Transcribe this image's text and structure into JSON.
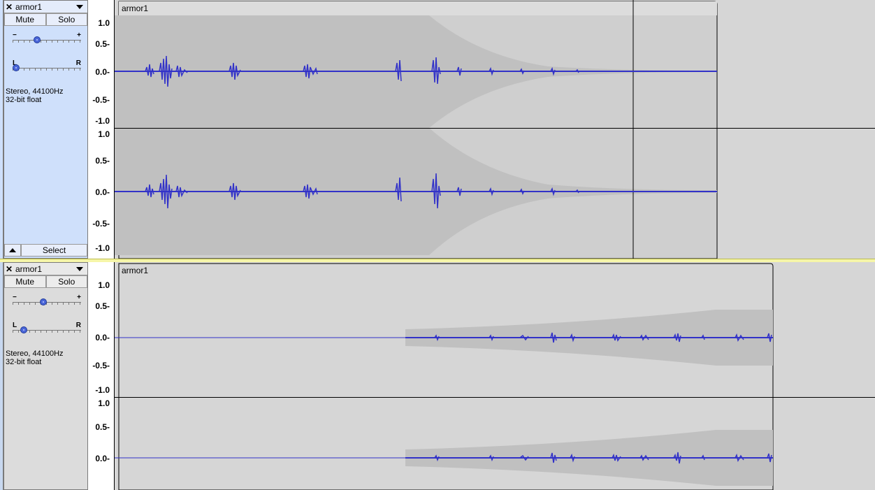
{
  "tracks": [
    {
      "name": "armor1",
      "mute_label": "Mute",
      "solo_label": "Solo",
      "gain_minus": "−",
      "gain_plus": "+",
      "gain_level": 0.34,
      "pan_left": "L",
      "pan_right": "R",
      "pan_level": 0.0,
      "info_line1": "Stereo, 44100Hz",
      "info_line2": "32-bit float",
      "select_label": "Select",
      "clip_name": "armor1",
      "ruler_top": [
        "1.0",
        "0.5-",
        "0.0-",
        "-0.5-",
        "-1.0"
      ],
      "ruler_bottom": [
        "1.0",
        "0.5-",
        "0.0-",
        "-0.5-",
        "-1.0"
      ]
    },
    {
      "name": "armor1",
      "mute_label": "Mute",
      "solo_label": "Solo",
      "gain_minus": "−",
      "gain_plus": "+",
      "gain_level": 0.44,
      "pan_left": "L",
      "pan_right": "R",
      "pan_level": 0.13,
      "info_line1": "Stereo, 44100Hz",
      "info_line2": "32-bit float",
      "clip_name": "armor1",
      "ruler_top": [
        "1.0",
        "0.5-",
        "0.0-",
        "-0.5-",
        "-1.0"
      ],
      "ruler_bottom": [
        "1.0",
        "0.5-",
        "0.0-"
      ]
    }
  ],
  "colors": {
    "waveform": "#3232c8",
    "envelope_fill": "#c0c0c0",
    "clip_bg": "#d6d6d6",
    "selected_panel": "#cfe0fb"
  },
  "icons": {
    "close": "close-icon",
    "menu": "dropdown-arrow-icon",
    "collapse": "collapse-up-icon"
  }
}
